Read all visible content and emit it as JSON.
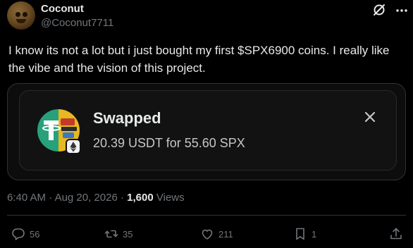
{
  "author": {
    "display_name": "Coconut",
    "handle": "@Coconut7711"
  },
  "tweet": {
    "text": "I know its not a lot but i just bought my first $SPX6900 coins. I really like the vibe and the vision of this project."
  },
  "swap_card": {
    "title": "Swapped",
    "detail": "20.39 USDT for 55.60 SPX",
    "icon": "usdt-spx-token-icon",
    "badge_icon": "ethereum-icon"
  },
  "meta": {
    "time": "6:40 AM",
    "separator": "·",
    "date": "Aug 20, 2026",
    "views_count": "1,600",
    "views_label": "Views"
  },
  "actions": {
    "replies": "56",
    "reposts": "35",
    "likes": "211",
    "bookmarks": "1"
  },
  "colors": {
    "background": "#000000",
    "text": "#e7e9ea",
    "muted": "#71767b",
    "tether_green": "#26a17b",
    "spx_gold": "#e8b820"
  }
}
